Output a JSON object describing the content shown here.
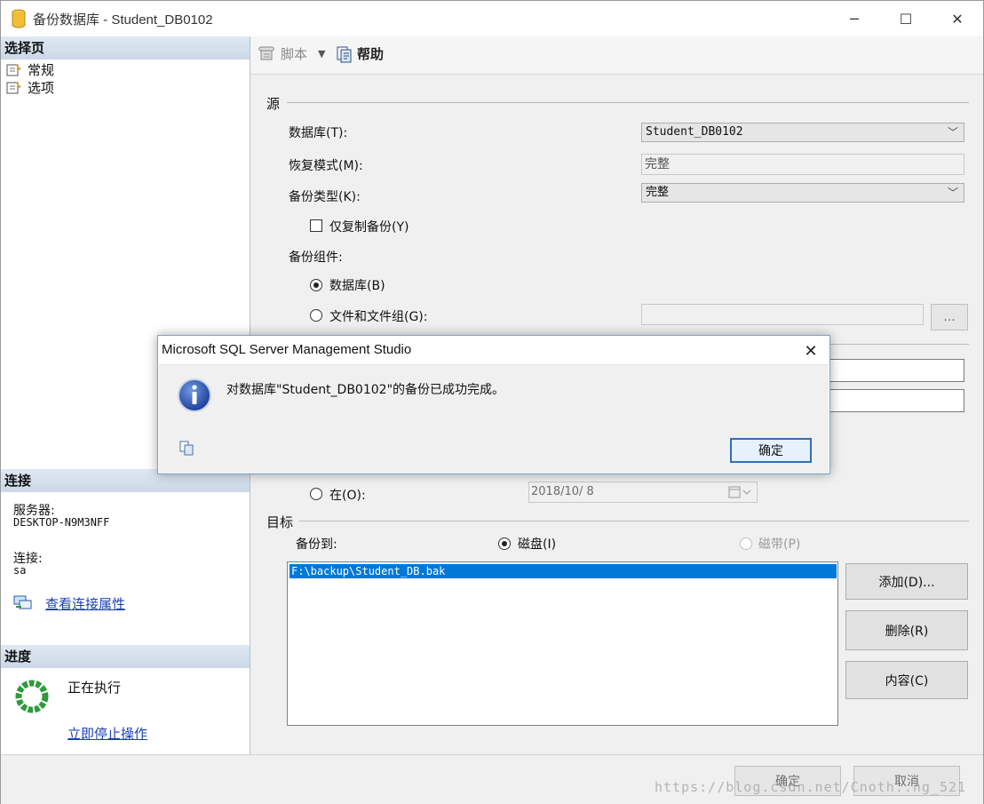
{
  "window": {
    "title": "备份数据库 - Student_DB0102",
    "minimize": "─",
    "maximize": "☐",
    "close": "✕"
  },
  "left": {
    "select_page_header": "选择页",
    "pages": [
      {
        "label": "常规"
      },
      {
        "label": "选项"
      }
    ],
    "connection_header": "连接",
    "server_label": "服务器:",
    "server_value": "DESKTOP-N9M3NFF",
    "connection_label": "连接:",
    "connection_value": "sa",
    "view_props_link": "查看连接属性",
    "progress_header": "进度",
    "progress_status": "正在执行",
    "stop_link": "立即停止操作"
  },
  "toolbar": {
    "script_label": "脚本",
    "help_label": "帮助"
  },
  "source": {
    "group_label": "源",
    "database_label": "数据库(T):",
    "database_value": "Student_DB0102",
    "recovery_label": "恢复模式(M):",
    "recovery_value": "完整",
    "backup_type_label": "备份类型(K):",
    "backup_type_value": "完整",
    "copy_only_label": "仅复制备份(Y)",
    "component_label": "备份组件:",
    "component_db_label": "数据库(B)",
    "component_files_label": "文件和文件组(G):",
    "browse_label": "..."
  },
  "expire": {
    "on_label": "在(O):",
    "on_date": "2018/10/ 8"
  },
  "destination": {
    "group_label": "目标",
    "backup_to_label": "备份到:",
    "disk_label": "磁盘(I)",
    "tape_label": "磁带(P)",
    "paths": [
      "F:\\backup\\Student_DB.bak"
    ],
    "add_label": "添加(D)...",
    "remove_label": "删除(R)",
    "contents_label": "内容(C)"
  },
  "footer": {
    "ok_label": "确定",
    "cancel_label": "取消",
    "watermark": "https://blog.csdn.net/Cnoth..ng_521"
  },
  "dialog": {
    "title": "Microsoft SQL Server Management Studio",
    "message": "对数据库\"Student_DB0102\"的备份已成功完成。",
    "ok_label": "确定",
    "close": "✕"
  },
  "colors": {
    "accent": "#0078d7",
    "section_header": "#d5e0ec",
    "link": "#1a3fb5",
    "progress_green": "#2e9a3a"
  }
}
